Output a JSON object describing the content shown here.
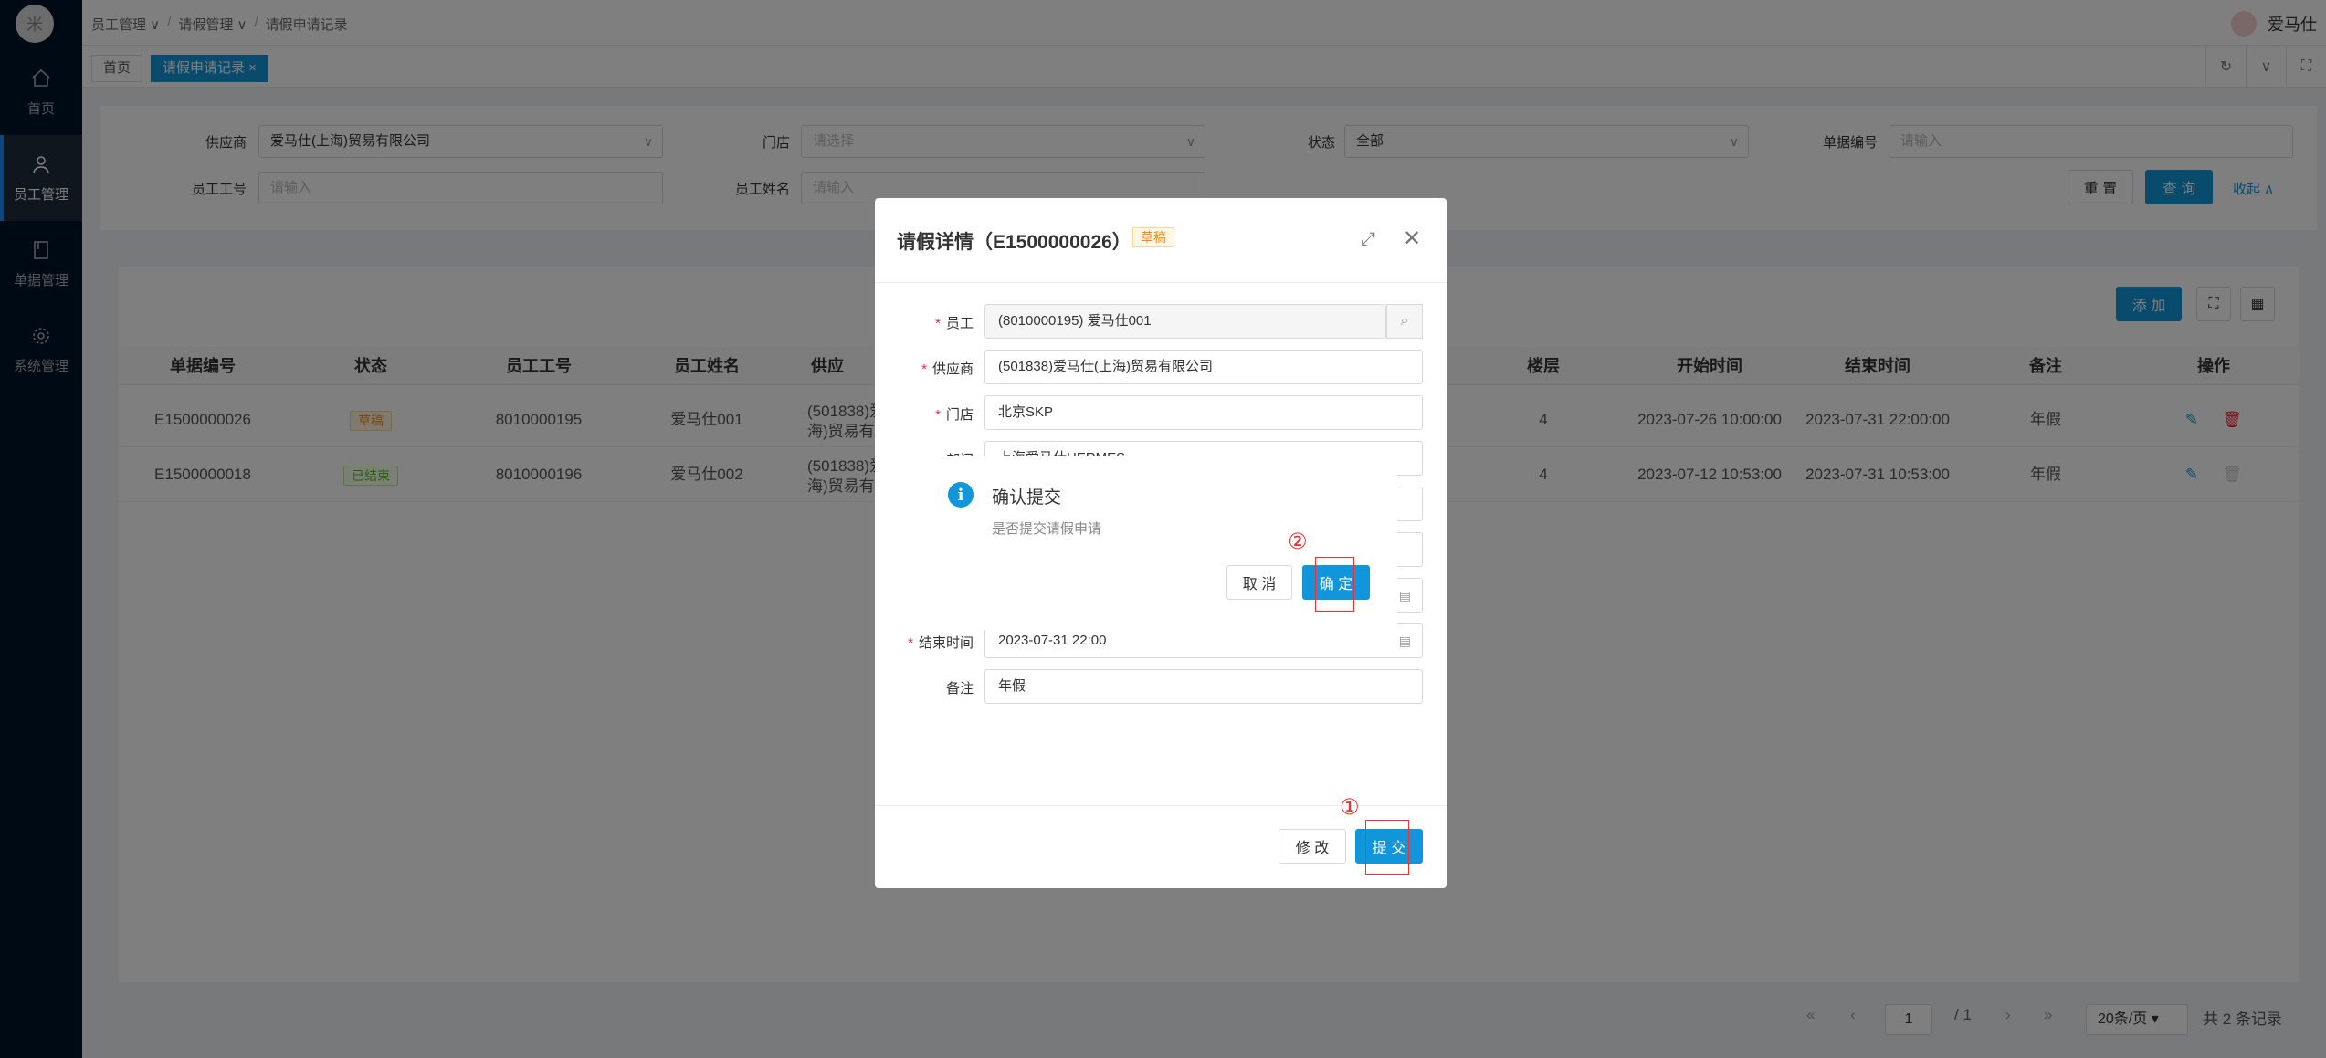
{
  "sidebar": {
    "logo_glyph": "米",
    "items": [
      {
        "label": "首页",
        "icon": "home-icon"
      },
      {
        "label": "员工管理",
        "icon": "user-icon"
      },
      {
        "label": "单据管理",
        "icon": "document-icon"
      },
      {
        "label": "系统管理",
        "icon": "gear-icon"
      }
    ]
  },
  "header": {
    "breadcrumb": [
      "员工管理 ∨",
      "请假管理 ∨",
      "请假申请记录"
    ],
    "user_name": "爱马仕"
  },
  "tabs": [
    {
      "label": "首页"
    },
    {
      "label": "请假申请记录 ×"
    }
  ],
  "search": {
    "supplier_label": "供应商",
    "supplier_value": "爱马仕(上海)贸易有限公司",
    "store_label": "门店",
    "store_placeholder": "请选择",
    "status_label": "状态",
    "status_value": "全部",
    "doc_no_label": "单据编号",
    "doc_no_placeholder": "请输入",
    "emp_no_label": "员工工号",
    "emp_no_placeholder": "请输入",
    "emp_name_label": "员工姓名",
    "emp_name_placeholder": "请输入",
    "reset_label": "重 置",
    "query_label": "查 询",
    "collapse_label": "收起 ∧"
  },
  "toolbar": {
    "add_label": "添 加"
  },
  "table": {
    "columns": [
      "单据编号",
      "状态",
      "员工工号",
      "员工姓名",
      "供应",
      "楼层",
      "开始时间",
      "结束时间",
      "备注",
      "操作"
    ],
    "rows": [
      {
        "doc_no": "E1500000026",
        "status": "草稿",
        "emp_no": "8010000195",
        "emp_name": "爱马仕001",
        "supplier_1": "(501838)爱",
        "supplier_2": "海)贸易有",
        "floor": "4",
        "start": "2023-07-26 10:00:00",
        "end": "2023-07-31 22:00:00",
        "remark": "年假"
      },
      {
        "doc_no": "E1500000018",
        "status": "已结束",
        "emp_no": "8010000196",
        "emp_name": "爱马仕002",
        "supplier_1": "(501838)爱",
        "supplier_2": "海)贸易有",
        "floor": "4",
        "start": "2023-07-12 10:53:00",
        "end": "2023-07-31 10:53:00",
        "remark": "年假"
      }
    ]
  },
  "pager": {
    "page": "1",
    "total_pages": "/ 1",
    "page_size": "20条/页 ▾",
    "total": "共 2 条记录"
  },
  "modal": {
    "title": "请假详情（E1500000026）",
    "status": "草稿",
    "fields": {
      "employee_label": "员工",
      "employee_value": "(8010000195) 爱马仕001",
      "supplier_label": "供应商",
      "supplier_value": "(501838)爱马仕(上海)贸易有限公司",
      "store_label": "门店",
      "store_value": "北京SKP",
      "brand_label": "部门",
      "brand_value": "上海爱马仕HERMES",
      "end_label": "结束时间",
      "end_value": "2023-07-31 22:00",
      "remark_label": "备注",
      "remark_value": "年假"
    },
    "edit_label": "修 改",
    "submit_label": "提 交"
  },
  "confirm": {
    "title": "确认提交",
    "message": "是否提交请假申请",
    "cancel_label": "取 消",
    "ok_label": "确 定"
  },
  "annotations": {
    "step1": "①",
    "step2": "②"
  }
}
